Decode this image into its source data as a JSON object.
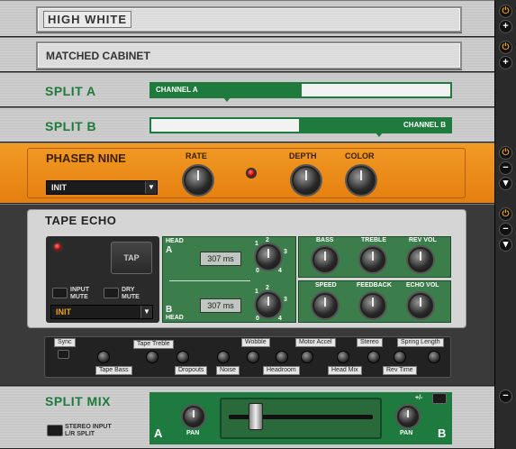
{
  "modules": {
    "high_white": {
      "title": "HIGH WHITE"
    },
    "matched_cabinet": {
      "title": "MATCHED CABINET"
    },
    "split_a": {
      "title": "SPLIT A",
      "channel_a": "CHANNEL A",
      "channel_b": ""
    },
    "split_b": {
      "title": "SPLIT B",
      "channel_a": "",
      "channel_b": "CHANNEL B"
    },
    "phaser": {
      "title": "PHASER NINE",
      "rate_label": "RATE",
      "depth_label": "DEPTH",
      "color_label": "COLOR",
      "preset": "INIT"
    },
    "tape_echo": {
      "title": "TAPE ECHO",
      "tap_label": "TAP",
      "input_mute": "INPUT\nMUTE",
      "dry_mute": "DRY\nMUTE",
      "preset": "INIT",
      "head_a_label": "HEAD",
      "head_a_letter": "A",
      "head_b_letter": "B",
      "head_b_label": "HEAD",
      "head_a_ms": "307 ms",
      "head_b_ms": "307 ms",
      "scale": {
        "s0": "0",
        "s1": "1",
        "s2": "2",
        "s3": "3",
        "s4": "4"
      },
      "knobs_top": {
        "bass": "BASS",
        "treble": "TREBLE",
        "rev_vol": "REV VOL"
      },
      "knobs_bottom": {
        "speed": "SPEED",
        "feedback": "FEEDBACK",
        "echo_vol": "ECHO VOL"
      },
      "strip": {
        "sync": "Sync",
        "tape_treble": "Tape Treble",
        "wobble": "Wobble",
        "motor_accel": "Motor Accel",
        "stereo": "Stereo",
        "spring_length": "Spring Length",
        "tape_bass": "Tape Bass",
        "dropouts": "Dropouts",
        "noise": "Noise",
        "headroom": "Headroom",
        "head_mix": "Head Mix",
        "rev_time": "Rev Time"
      }
    },
    "split_mix": {
      "title": "SPLIT MIX",
      "stereo_input": "STEREO INPUT\nL/R SPLIT",
      "letter_a": "A",
      "letter_b": "B",
      "pan_left": "PAN",
      "pan_right": "PAN",
      "plus_minus": "+/-"
    }
  },
  "side": {
    "power": "⏻",
    "plus": "+",
    "minus": "−",
    "down": "▾"
  },
  "colors": {
    "green": "#1f7a3e",
    "orange": "#f29a24",
    "led_red": "#b00000"
  }
}
